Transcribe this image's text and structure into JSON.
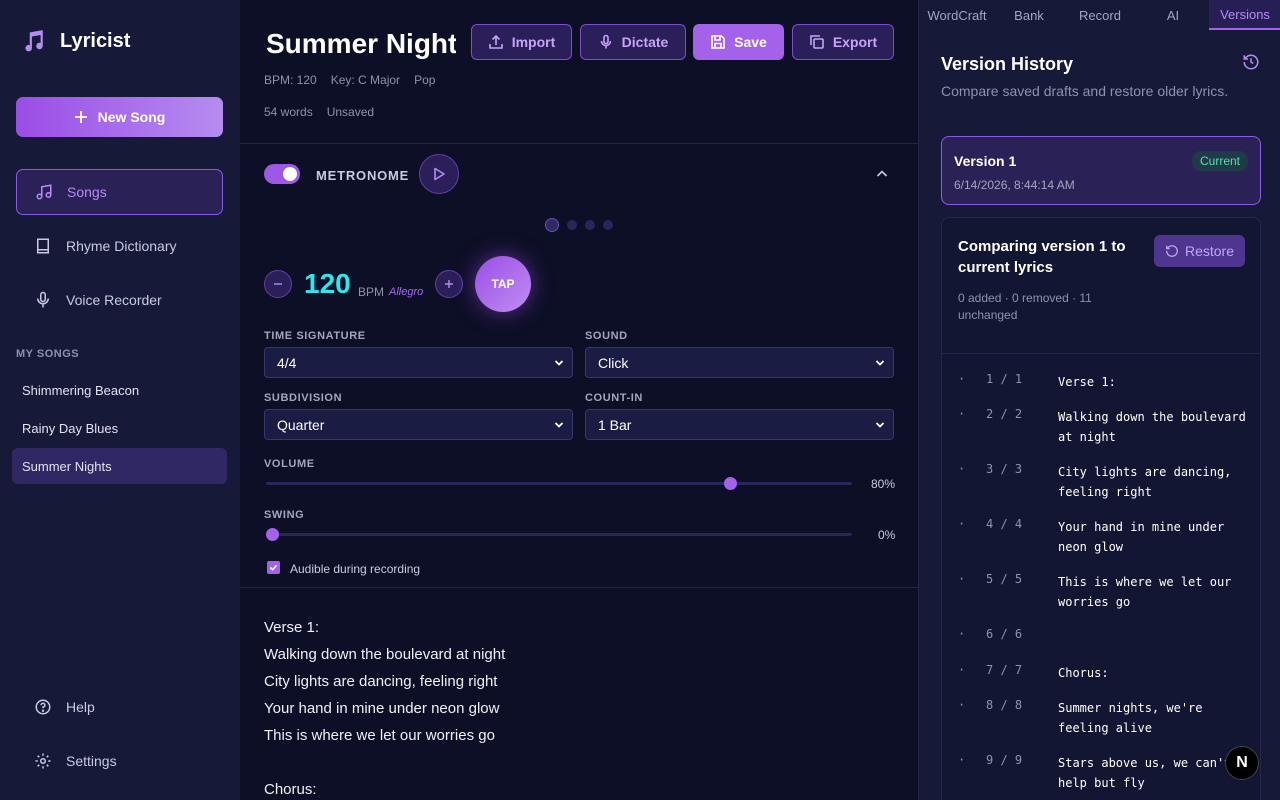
{
  "app": {
    "name": "Lyricist"
  },
  "sidebar": {
    "new_song_label": "New Song",
    "nav": [
      {
        "label": "Songs"
      },
      {
        "label": "Rhyme Dictionary"
      },
      {
        "label": "Voice Recorder"
      }
    ],
    "section_label": "MY SONGS",
    "songs": [
      {
        "title": "Shimmering Beacon"
      },
      {
        "title": "Rainy Day Blues"
      },
      {
        "title": "Summer Nights"
      }
    ],
    "help_label": "Help",
    "settings_label": "Settings"
  },
  "song": {
    "title": "Summer Nights",
    "bpm_text": "BPM: 120",
    "key_text": "Key: C Major",
    "genre": "Pop",
    "word_count": "54 words",
    "save_status": "Unsaved"
  },
  "toolbar": {
    "import_label": "Import",
    "dictate_label": "Dictate",
    "save_label": "Save",
    "export_label": "Export"
  },
  "metronome": {
    "label": "METRONOME",
    "enabled": true,
    "bpm": "120",
    "bpm_unit": "BPM",
    "tempo_name": "Allegro",
    "tap_label": "TAP",
    "time_signature_label": "TIME SIGNATURE",
    "time_signature_value": "4/4",
    "sound_label": "SOUND",
    "sound_value": "Click",
    "subdivision_label": "SUBDIVISION",
    "subdivision_value": "Quarter",
    "count_in_label": "COUNT-IN",
    "count_in_value": "1 Bar",
    "volume_label": "VOLUME",
    "volume_value": "80%",
    "volume_level": 0.8,
    "swing_label": "SWING",
    "swing_value": "0%",
    "swing_level": 0,
    "audible_label": "Audible during recording",
    "audible_checked": true
  },
  "lyrics": [
    "Verse 1:",
    "Walking down the boulevard at night",
    "City lights are dancing, feeling right",
    "Your hand in mine under neon glow",
    "This is where we let our worries go",
    "",
    "Chorus:"
  ],
  "right_panel": {
    "tabs": [
      {
        "label": "WordCraft"
      },
      {
        "label": "Bank"
      },
      {
        "label": "Record"
      },
      {
        "label": "AI"
      },
      {
        "label": "Versions"
      }
    ],
    "title": "Version History",
    "description": "Compare saved drafts and restore older lyrics.",
    "version": {
      "name": "Version 1",
      "badge": "Current",
      "date": "6/14/2026, 8:44:14 AM"
    },
    "compare_title": "Comparing version 1 to current lyrics",
    "restore_label": "Restore",
    "summary": "0 added · 0 removed · 11 unchanged",
    "diff": [
      {
        "bullet": "·",
        "num": "1 / 1",
        "text": "Verse 1:"
      },
      {
        "bullet": "·",
        "num": "2 / 2",
        "text": "Walking down the boulevard at night"
      },
      {
        "bullet": "·",
        "num": "3 / 3",
        "text": "City lights are dancing, feeling right"
      },
      {
        "bullet": "·",
        "num": "4 / 4",
        "text": "Your hand in mine under neon glow"
      },
      {
        "bullet": "·",
        "num": "5 / 5",
        "text": "This is where we let our worries go"
      },
      {
        "bullet": "·",
        "num": "6 / 6",
        "text": ""
      },
      {
        "bullet": "·",
        "num": "7 / 7",
        "text": "Chorus:"
      },
      {
        "bullet": "·",
        "num": "8 / 8",
        "text": "Summer nights, we're feeling alive"
      },
      {
        "bullet": "·",
        "num": "9 / 9",
        "text": "Stars above us, we can't help but fly"
      }
    ]
  },
  "dev_badge": "N"
}
